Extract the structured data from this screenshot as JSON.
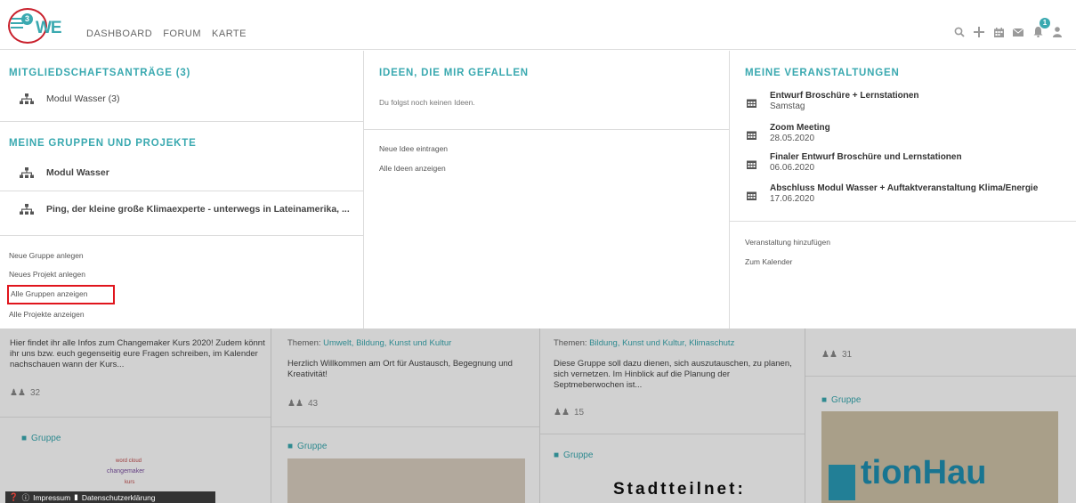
{
  "header": {
    "menu_badge": "3",
    "logo": "WE",
    "nav": [
      "DASHBOARD",
      "FORUM",
      "KARTE"
    ],
    "bell_badge": "1",
    "icons": [
      "search-icon",
      "plus-icon",
      "calendar-icon",
      "mail-icon",
      "bell-icon",
      "user-icon"
    ]
  },
  "col1": {
    "membership_title": "MITGLIEDSCHAFTSANTRÄGE (3)",
    "membership_item": "Modul Wasser (3)",
    "groups_title": "MEINE GRUPPEN UND PROJEKTE",
    "groups": [
      "Modul Wasser",
      "Ping, der kleine große Klimaexperte - unterwegs in Lateinamerika, ..."
    ],
    "links": [
      "Neue Gruppe anlegen",
      "Neues Projekt anlegen",
      "Alle Gruppen anzeigen",
      "Alle Projekte anzeigen"
    ]
  },
  "col2": {
    "title": "IDEEN, DIE MIR GEFALLEN",
    "empty": "Du folgst noch keinen Ideen.",
    "links": [
      "Neue Idee eintragen",
      "Alle Ideen anzeigen"
    ]
  },
  "col3": {
    "title": "MEINE VERANSTALTUNGEN",
    "events": [
      {
        "title": "Entwurf Broschüre + Lernstationen",
        "date": "Samstag"
      },
      {
        "title": "Zoom Meeting",
        "date": "28.05.2020"
      },
      {
        "title": "Finaler Entwurf Broschüre und Lernstationen",
        "date": "06.06.2020"
      },
      {
        "title": "Abschluss Modul Wasser + Auftaktveranstaltung Klima/Energie",
        "date": "17.06.2020"
      }
    ],
    "links": [
      "Veranstaltung hinzufügen",
      "Zum Kalender"
    ]
  },
  "background": {
    "card1": {
      "text": "Hier findet ihr alle Infos zum Changemaker Kurs 2020! Zudem könnt ihr uns bzw. euch gegenseitig eure Fragen schreiben, im Kalender nachschauen wann der Kurs...",
      "members": "32",
      "type": "Gruppe"
    },
    "card2": {
      "themes_prefix": "Themen:",
      "themes": "Umwelt, Bildung, Kunst und Kultur",
      "text": "Herzlich Willkommen am Ort für Austausch, Begegnung und Kreativität!",
      "members": "43",
      "type": "Gruppe"
    },
    "card3": {
      "themes_prefix": "Themen:",
      "themes": "Bildung, Kunst und Kultur, Klimaschutz",
      "text": "Diese Gruppe soll dazu dienen, sich auszutauschen, zu planen, sich vernetzen. Im Hinblick auf die Planung der Septmeberwochen ist...",
      "members": "15",
      "type": "Gruppe",
      "image_text": "Stadtteilnet:"
    },
    "card4": {
      "members": "31",
      "type": "Gruppe",
      "image_text": "tionHau"
    }
  },
  "footer": {
    "impressum": "Impressum",
    "datenschutz": "Datenschutzerklärung"
  }
}
